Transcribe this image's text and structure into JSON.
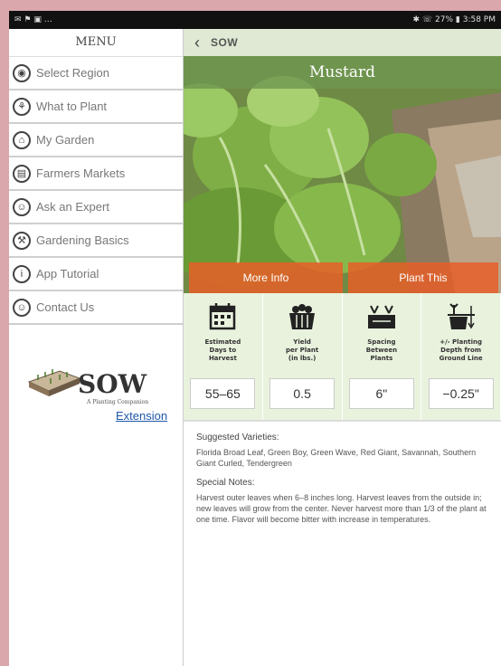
{
  "statusbar": {
    "left": "✉ ⚑ ▣ …",
    "right": "✱ ☏ 27% ▮ 3:58 PM"
  },
  "menu": {
    "title": "MENU",
    "items": [
      {
        "label": "Select Region",
        "icon": "location-pin-icon",
        "glyph": "◉"
      },
      {
        "label": "What to Plant",
        "icon": "seedling-icon",
        "glyph": "⚘"
      },
      {
        "label": "My Garden",
        "icon": "garden-icon",
        "glyph": "⌂"
      },
      {
        "label": "Farmers Markets",
        "icon": "basket-icon",
        "glyph": "▤"
      },
      {
        "label": "Ask an Expert",
        "icon": "expert-icon",
        "glyph": "☺"
      },
      {
        "label": "Gardening Basics",
        "icon": "tools-icon",
        "glyph": "⚒"
      },
      {
        "label": "App Tutorial",
        "icon": "info-icon",
        "glyph": "i"
      },
      {
        "label": "Contact Us",
        "icon": "contact-icon",
        "glyph": "☺"
      }
    ]
  },
  "logo": {
    "brand": "SOW",
    "tagline": "A Planting Companion"
  },
  "extension_label": "Extension",
  "topbar": {
    "crumb": "SOW"
  },
  "plant": {
    "name": "Mustard",
    "more_info": "More Info",
    "plant_this": "Plant This"
  },
  "stats": [
    {
      "label": "Estimated\nDays to\nHarvest",
      "value": "55–65",
      "icon": "calendar-icon"
    },
    {
      "label": "Yield\nper Plant\n(in lbs.)",
      "value": "0.5",
      "icon": "bushel-icon"
    },
    {
      "label": "Spacing\nBetween\nPlants",
      "value": "6\"",
      "icon": "spacing-icon"
    },
    {
      "label": "+/- Planting\nDepth from\nGround Line",
      "value": "−0.25\"",
      "icon": "depth-icon"
    }
  ],
  "notes": {
    "varieties_heading": "Suggested Varieties:",
    "varieties": "Florida Broad Leaf, Green Boy, Green Wave, Red Giant, Savannah, Southern Giant Curled, Tendergreen",
    "special_heading": "Special Notes:",
    "special": "Harvest outer leaves when 6–8 inches long. Harvest leaves from the outside in; new leaves will grow from the center. Never harvest more than 1/3 of the plant at one time. Flavor will become bitter with increase in temperatures."
  },
  "colors": {
    "accent": "#e6602a",
    "panel": "#e8f2dd",
    "topbar": "#dfe9d3",
    "frame": "#d9a7ac"
  }
}
